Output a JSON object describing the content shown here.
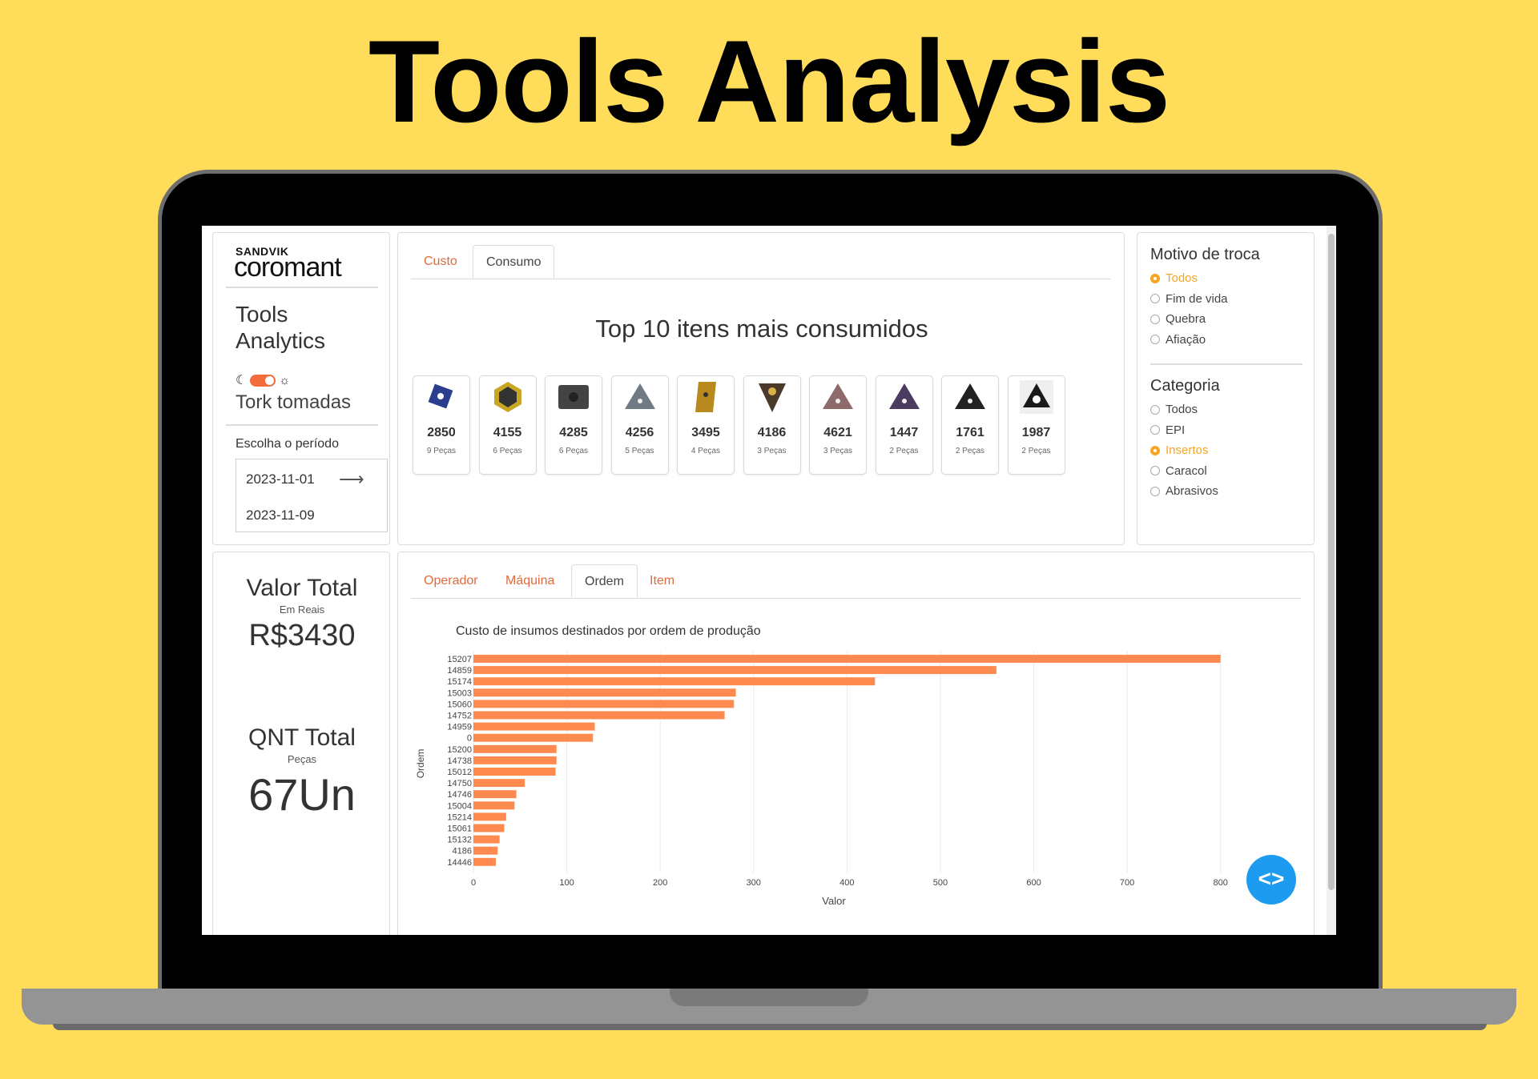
{
  "hero": {
    "title": "Tools Analysis"
  },
  "brand": {
    "small": "SANDVIK",
    "big": "coromant"
  },
  "app": {
    "title": "Tools Analytics",
    "company": "Tork tomadas"
  },
  "period": {
    "label": "Escolha o período",
    "start": "2023-11-01",
    "end": "2023-11-09"
  },
  "kpis": {
    "valor": {
      "title": "Valor Total",
      "sub": "Em Reais",
      "value": "R$3430"
    },
    "qnt": {
      "title": "QNT Total",
      "sub": "Peças",
      "value": "67Un"
    }
  },
  "top_tabs": {
    "custo": "Custo",
    "consumo": "Consumo",
    "active": "Consumo"
  },
  "top10": {
    "title": "Top 10 itens mais consumidos",
    "items": [
      {
        "code": "2850",
        "qty": "9 Peças",
        "color": "#2a3d8f"
      },
      {
        "code": "4155",
        "qty": "6 Peças",
        "color": "#c9a623"
      },
      {
        "code": "4285",
        "qty": "6 Peças",
        "color": "#444444"
      },
      {
        "code": "4256",
        "qty": "5 Peças",
        "color": "#6f7a84"
      },
      {
        "code": "3495",
        "qty": "4 Peças",
        "color": "#b88a1e"
      },
      {
        "code": "4186",
        "qty": "3 Peças",
        "color": "#4a3a2a"
      },
      {
        "code": "4621",
        "qty": "3 Peças",
        "color": "#8e6a6a"
      },
      {
        "code": "1447",
        "qty": "2 Peças",
        "color": "#4b3b5f"
      },
      {
        "code": "1761",
        "qty": "2 Peças",
        "color": "#222222"
      },
      {
        "code": "1987",
        "qty": "2 Peças",
        "color": "#1a1a1a"
      }
    ]
  },
  "filters": {
    "motivo": {
      "title": "Motivo de troca",
      "options": [
        "Todos",
        "Fim de vida",
        "Quebra",
        "Afiação"
      ],
      "selected": 0
    },
    "categoria": {
      "title": "Categoria",
      "options": [
        "Todos",
        "EPI",
        "Insertos",
        "Caracol",
        "Abrasivos"
      ],
      "selected": 2
    }
  },
  "bottom_tabs": {
    "operador": "Operador",
    "maquina": "Máquina",
    "ordem": "Ordem",
    "item": "Item",
    "active": "Ordem"
  },
  "chart_data": {
    "type": "bar",
    "orientation": "horizontal",
    "title": "Custo de insumos destinados por ordem de produção",
    "xlabel": "Valor",
    "ylabel": "Ordem",
    "xlim": [
      0,
      820
    ],
    "xticks": [
      0,
      100,
      200,
      300,
      400,
      500,
      600,
      700,
      800
    ],
    "color": "#ff8a50",
    "categories": [
      "15207",
      "14859",
      "15174",
      "15003",
      "15060",
      "14752",
      "14959",
      "0",
      "15200",
      "14738",
      "15012",
      "14750",
      "14746",
      "15004",
      "15214",
      "15061",
      "15132",
      "4186",
      "14446"
    ],
    "values": [
      800,
      560,
      430,
      281,
      279,
      269,
      130,
      128,
      89,
      89,
      88,
      55,
      46,
      44,
      35,
      33,
      28,
      26,
      24
    ]
  },
  "fab": {
    "label": "<>"
  }
}
